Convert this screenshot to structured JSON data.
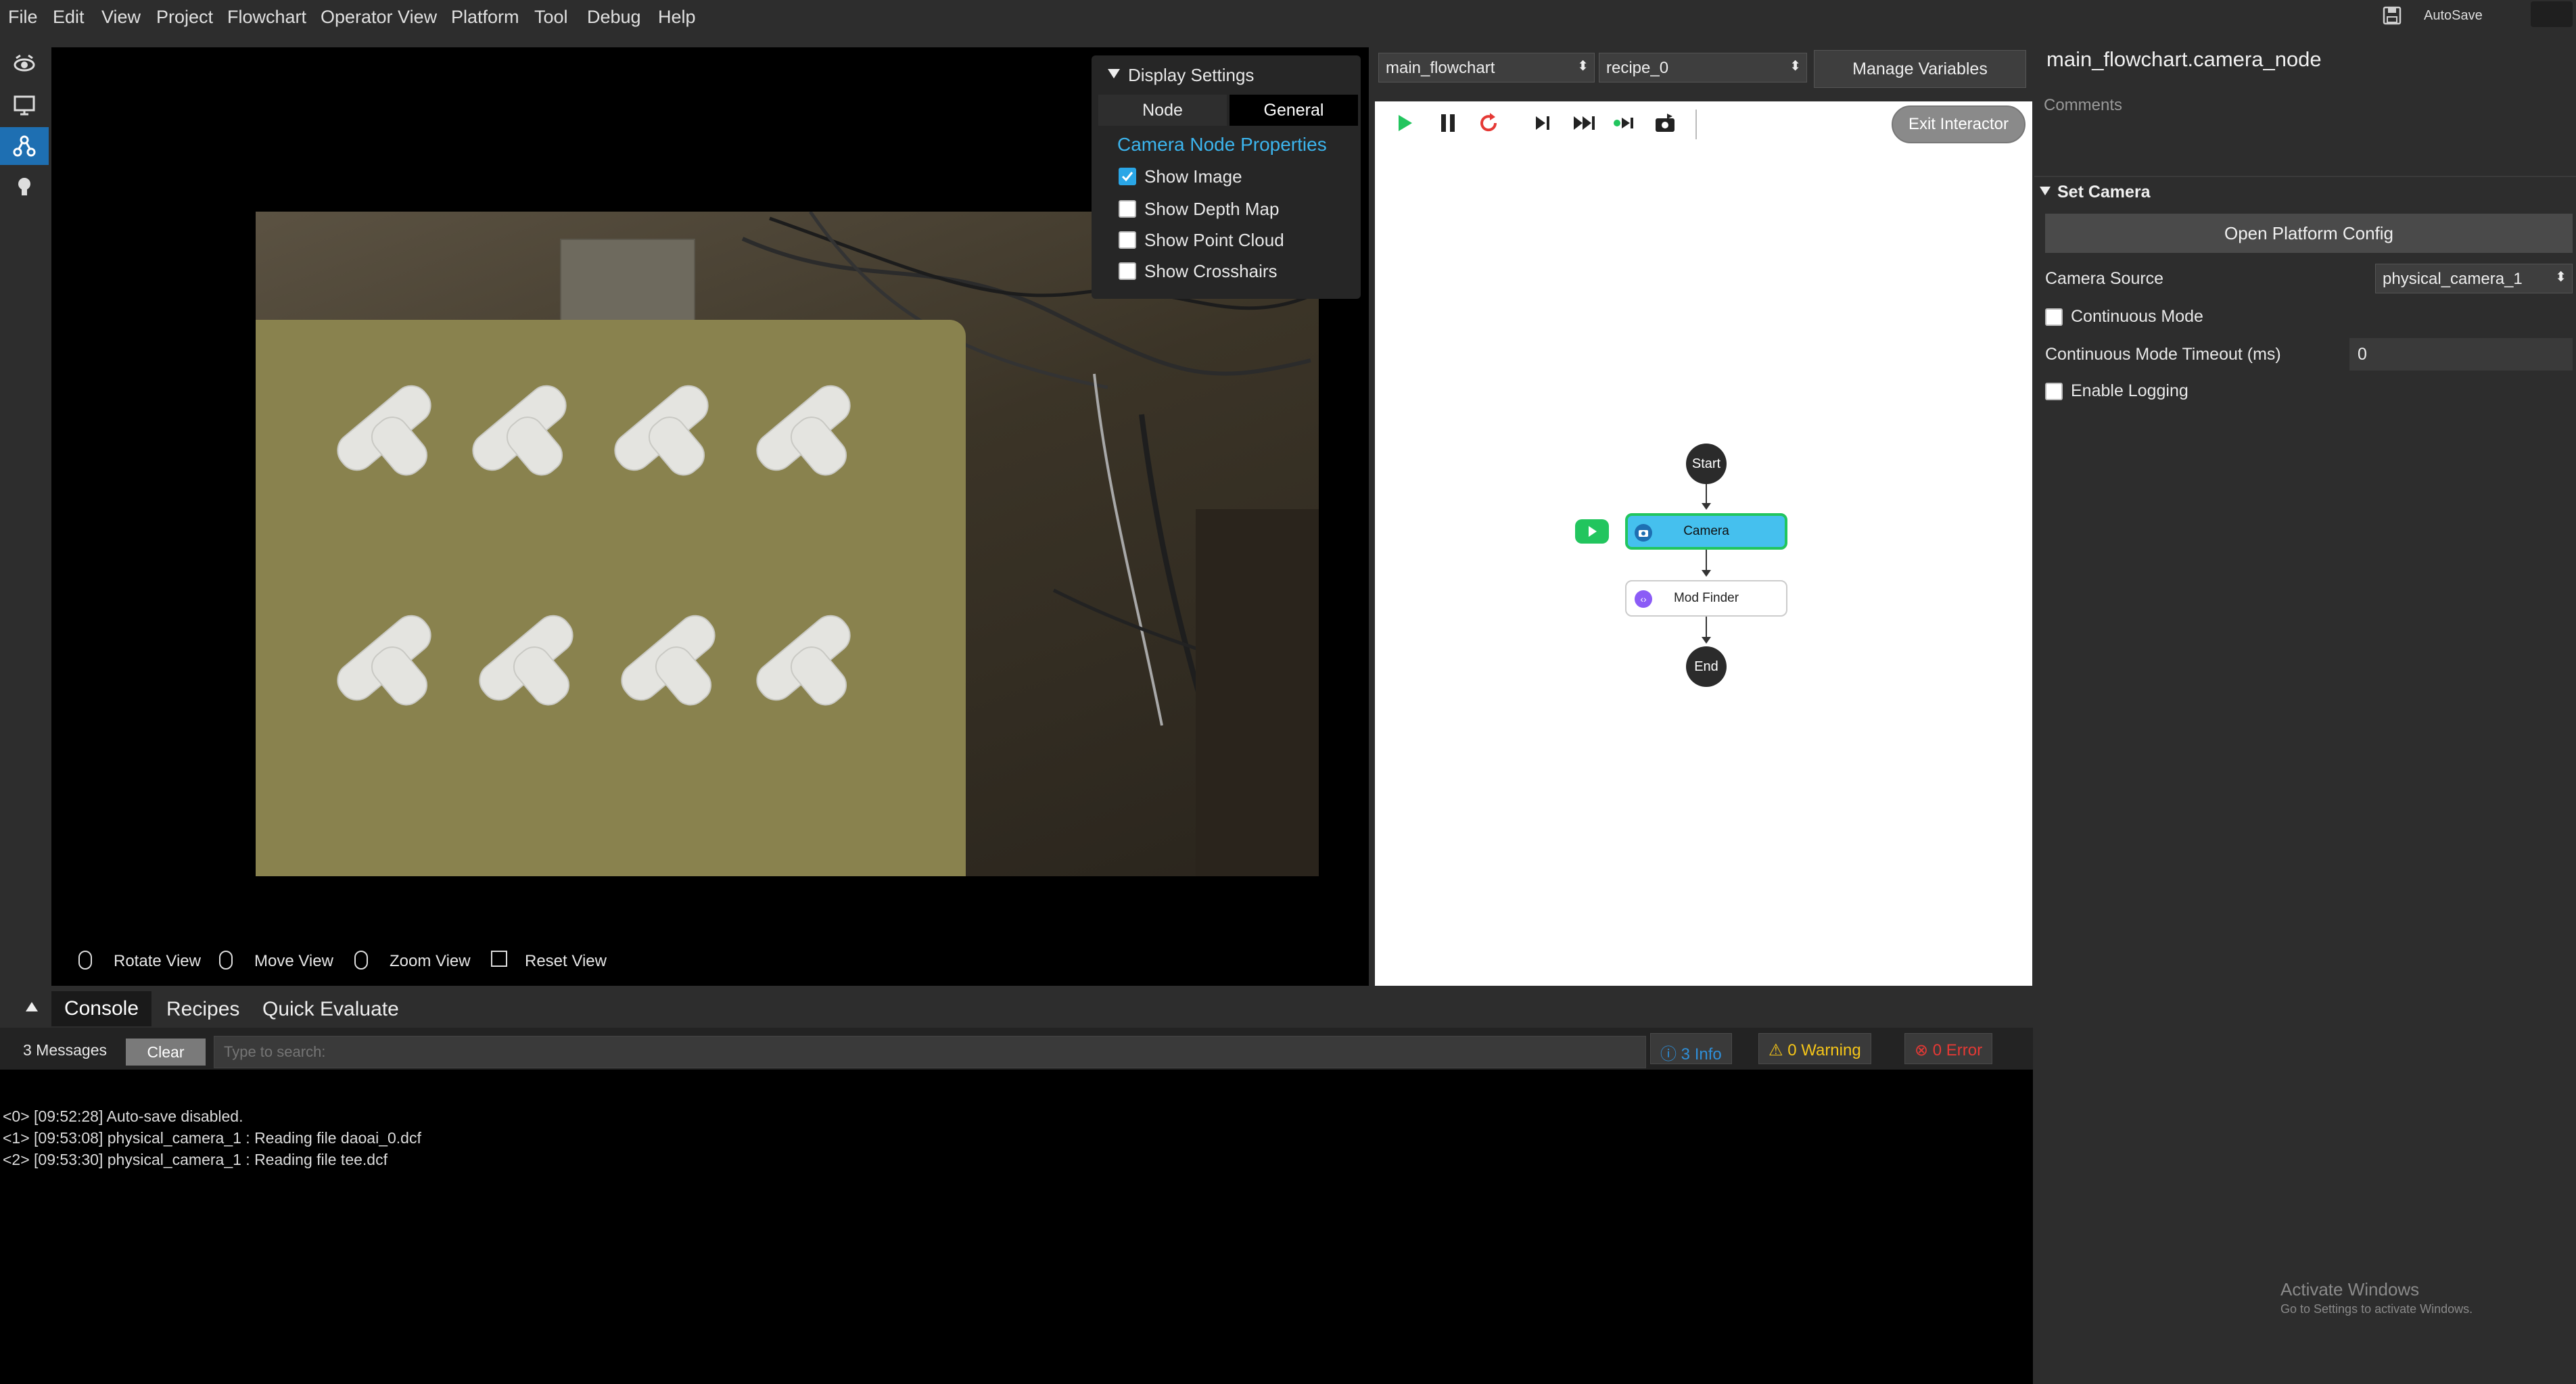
{
  "menu": [
    "File",
    "Edit",
    "View",
    "Project",
    "Flowchart",
    "Operator View",
    "Platform",
    "Tool",
    "Debug",
    "Help"
  ],
  "autosave_label": "AutoSave",
  "rail_icons": [
    "eye-camera-icon",
    "monitor-icon",
    "flowchart-icon",
    "bulb-icon"
  ],
  "view_controls": {
    "rotate": "Rotate View",
    "move": "Move View",
    "zoom": "Zoom View",
    "reset": "Reset View"
  },
  "display_settings": {
    "title": "Display Settings",
    "tab_node": "Node",
    "tab_general": "General",
    "section": "Camera Node Properties",
    "options": [
      {
        "label": "Show Image",
        "checked": true
      },
      {
        "label": "Show Depth Map",
        "checked": false
      },
      {
        "label": "Show Point Cloud",
        "checked": false
      },
      {
        "label": "Show Crosshairs",
        "checked": false
      }
    ]
  },
  "flowchart": {
    "select_flowchart": "main_flowchart",
    "select_recipe": "recipe_0",
    "manage_variables": "Manage Variables",
    "exit_interactor": "Exit Interactor",
    "nodes": {
      "start": "Start",
      "camera": "Camera",
      "mod_finder": "Mod Finder",
      "end": "End"
    },
    "colors": {
      "camera_fill": "#45c0ee",
      "camera_border": "#22c55e",
      "play": "#22c55e",
      "restart": "#e53935"
    }
  },
  "props": {
    "node_title": "main_flowchart.camera_node",
    "comments": "Comments",
    "section": "Set Camera",
    "open_platform_config": "Open Platform Config",
    "camera_source_label": "Camera Source",
    "camera_source_value": "physical_camera_1",
    "continuous_mode": "Continuous Mode",
    "timeout_label": "Continuous Mode Timeout (ms)",
    "timeout_value": "0",
    "enable_logging": "Enable Logging"
  },
  "console": {
    "tabs": [
      "Console",
      "Recipes",
      "Quick Evaluate"
    ],
    "messages_count": "3 Messages",
    "clear": "Clear",
    "search_placeholder": "Type to search:",
    "info": "3 Info",
    "warning": "0 Warning",
    "error": "0 Error",
    "lines": [
      "<0> [09:52:28] Auto-save disabled.",
      "<1> [09:53:08] physical_camera_1 : Reading file daoai_0.dcf",
      "<2> [09:53:30] physical_camera_1 : Reading file tee.dcf"
    ]
  },
  "watermark": {
    "line1": "Activate Windows",
    "line2": "Go to Settings to activate Windows."
  }
}
